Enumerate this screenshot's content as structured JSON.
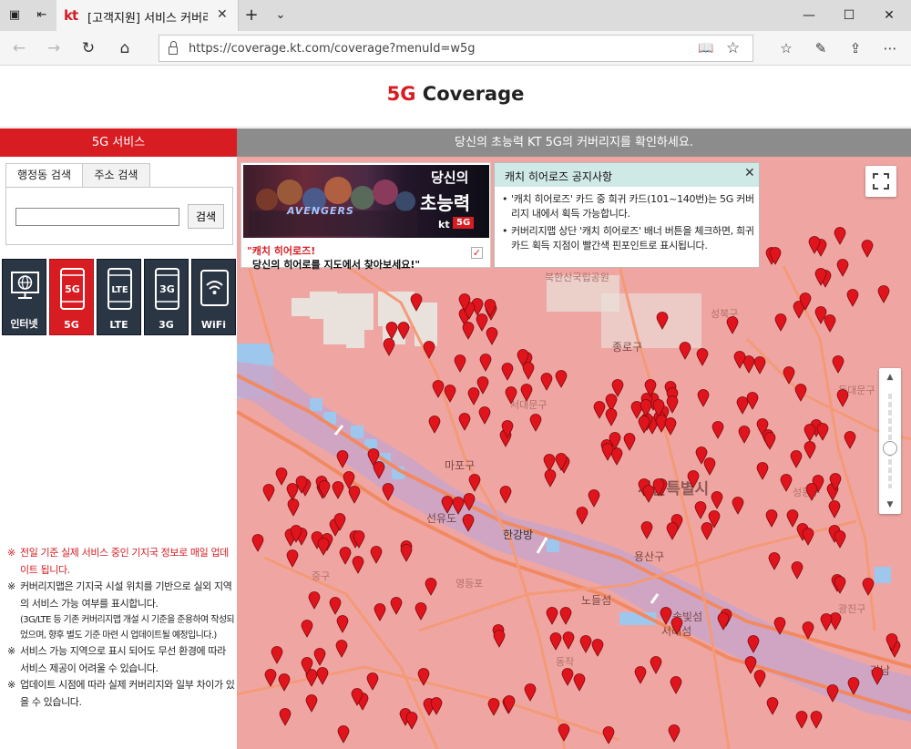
{
  "browser": {
    "tab_title": "[고객지원] 서비스 커버리",
    "tab_logo": "kt",
    "url": "https://coverage.kt.com/coverage?menuId=w5g"
  },
  "page": {
    "title_red": "5G",
    "title_rest": " Coverage"
  },
  "left": {
    "header": "5G 서비스",
    "tabs": [
      "행정동 검색",
      "주소 검색"
    ],
    "search_button": "검색",
    "search_value": "",
    "services": [
      {
        "label": "인터넷",
        "icon": "monitor-globe-icon"
      },
      {
        "label": "5G",
        "icon": "phone-5g-icon",
        "code": "5G"
      },
      {
        "label": "LTE",
        "icon": "phone-lte-icon",
        "code": "LTE"
      },
      {
        "label": "3G",
        "icon": "phone-3g-icon",
        "code": "3G"
      },
      {
        "label": "WiFi",
        "icon": "wifi-icon"
      }
    ],
    "active_service": "5G",
    "notes": {
      "mark": "※",
      "n1": "전일 기준 실제 서비스 중인 기지국 정보로 매일 업데이트 됩니다.",
      "n2": "커버리지맵은 기지국 시설 위치를 기반으로 실외 지역의 서비스 가능 여부를 표시합니다.",
      "n2_sub": "(3G/LTE 등 기존 커버리지맵 개설 시 기준을 준용하여 작성되었으며, 향후 별도 기준 마련 시 업데이트될 예정입니다.)",
      "n3": "서비스 가능 지역으로 표시 되어도 무선 환경에 따라 서비스 제공이 어려울 수 있습니다.",
      "n4": "업데이트 시점에 따라 실제 커버리지와 일부 차이가 있을 수 있습니다."
    }
  },
  "map": {
    "header": "당신의 초능력 KT 5G의 커버리지를 확인하세요.",
    "banner": {
      "heading_small": "당신의",
      "heading_big": "초능력",
      "brand": "kt",
      "badge": "5G",
      "logo_text": "AVENGERS",
      "line1": "\"캐치 히어로즈!",
      "line2": "당신의 히어로를 지도에서 찾아보세요!\"",
      "checked": true,
      "check_mark": "✓"
    },
    "notice": {
      "title": "캐치 히어로즈 공지사항",
      "bullets": [
        "'캐치 히어로즈' 카드 중 희귀 카드(101~140번)는 5G 커버리지 내에서 획득 가능합니다.",
        "커버리지맵 상단 '캐치 히어로즈' 배너 버튼을 체크하면, 희귀 카드 획득 지점이 빨간색 핀포인트로 표시됩니다."
      ]
    },
    "labels": {
      "seoul": "서울특별시",
      "hangang_bridge": "한강",
      "hangang_bridge2": "방",
      "mapo": "마포구",
      "jongno": "종로구",
      "seodaemun": "서대문구",
      "yongsan": "용산구",
      "seoulforest": "북한산국립공원",
      "yeouido": "선유도",
      "jung": "중구",
      "dongdaemun": "동대문구",
      "seongbuk": "성북구",
      "seongdong": "성동구",
      "seocho": "서래섬",
      "banpo": "솔빛섬",
      "nodeul": "노들섬",
      "gangnam": "강남",
      "dongjak": "동작",
      "yeongdeungpo": "영등포",
      "gwangjin": "광진구"
    },
    "colors": {
      "coverage": "#efa6a2",
      "pin": "#e0141c",
      "river": "#c8a0c8"
    }
  }
}
